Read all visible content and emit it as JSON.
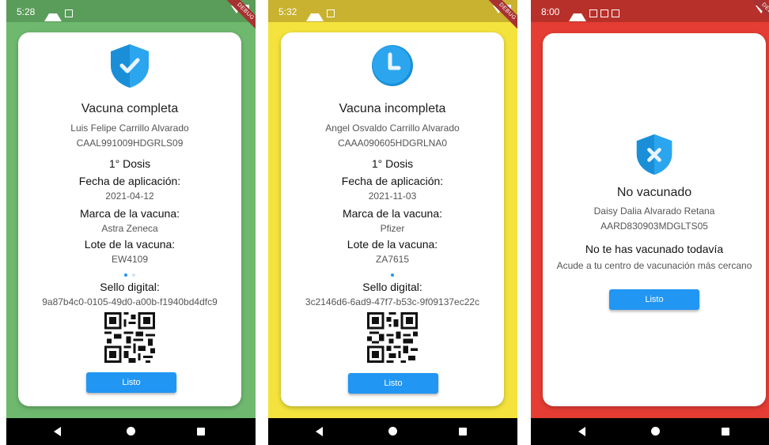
{
  "phones": [
    {
      "status_time": "5:28",
      "debug_label": "DEBUG",
      "colors": {
        "background": "#6fb96f",
        "status_bar": "#5a9c5a"
      },
      "icon": "shield-check-icon",
      "title": "Vacuna completa",
      "name": "Luis Felipe Carrillo Alvarado",
      "curp": "CAAL991009HDGRLS09",
      "dose": "1° Dosis",
      "fecha_label": "Fecha de aplicación:",
      "fecha_value": "2021-04-12",
      "marca_label": "Marca de la vacuna:",
      "marca_value": "Astra Zeneca",
      "lote_label": "Lote de la vacuna:",
      "lote_value": "EW4109",
      "sello_label": "Sello digital:",
      "sello_value": "9a87b4c0-0105-49d0-a00b-f1940bd4dfc9",
      "button": "Listo"
    },
    {
      "status_time": "5:32",
      "debug_label": "DEBUG",
      "colors": {
        "background": "#f4e33c",
        "status_bar": "#c9b22f"
      },
      "icon": "clock-icon",
      "title": "Vacuna incompleta",
      "name": "Angel Osvaldo Carrillo Alvarado",
      "curp": "CAAA090605HDGRLNA0",
      "dose": "1° Dosis",
      "fecha_label": "Fecha de aplicación:",
      "fecha_value": "2021-11-03",
      "marca_label": "Marca de la vacuna:",
      "marca_value": "Pfizer",
      "lote_label": "Lote de la vacuna:",
      "lote_value": "ZA7615",
      "sello_label": "Sello digital:",
      "sello_value": "3c2146d6-6ad9-47f7-b53c-9f09137ec22c",
      "button": "Listo"
    },
    {
      "status_time": "8:00",
      "debug_label": "DEBUG",
      "colors": {
        "background": "#e53d33",
        "status_bar": "#b8302a"
      },
      "icon": "shield-x-icon",
      "title": "No vacunado",
      "name": "Daisy Dalia Alvarado Retana",
      "curp": "AARD830903MDGLTS05",
      "subtitle": "No te has vacunado todavía",
      "message": "Acude a tu centro de vacunación más cercano",
      "button": "Listo"
    }
  ],
  "accent": "#2196f3"
}
